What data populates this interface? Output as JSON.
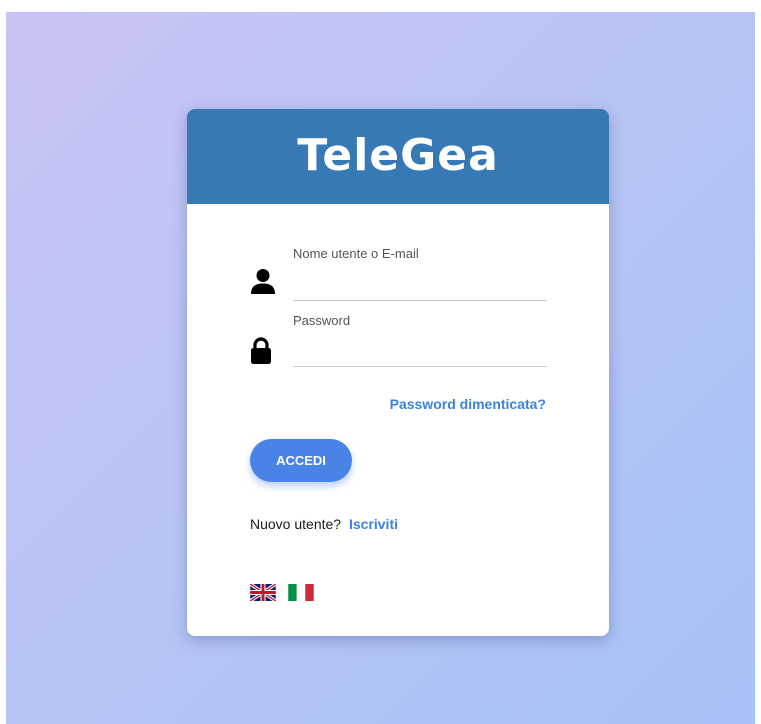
{
  "app": {
    "logo_text": "TeleGea"
  },
  "login_form": {
    "username_label": "Nome utente o E-mail",
    "username_value": "",
    "password_label": "Password",
    "password_value": "",
    "forgot_password_link": "Password dimenticata?",
    "submit_label": "ACCEDI",
    "new_user_text": "Nuovo utente?",
    "signup_link": "Iscriviti"
  },
  "languages": [
    {
      "name": "English",
      "icon": "uk-flag-icon"
    },
    {
      "name": "Italiano",
      "icon": "italy-flag-icon"
    }
  ],
  "colors": {
    "header_blue": "#3679b4",
    "accent_blue": "#4a83e6",
    "link_blue": "#3b82e0"
  }
}
